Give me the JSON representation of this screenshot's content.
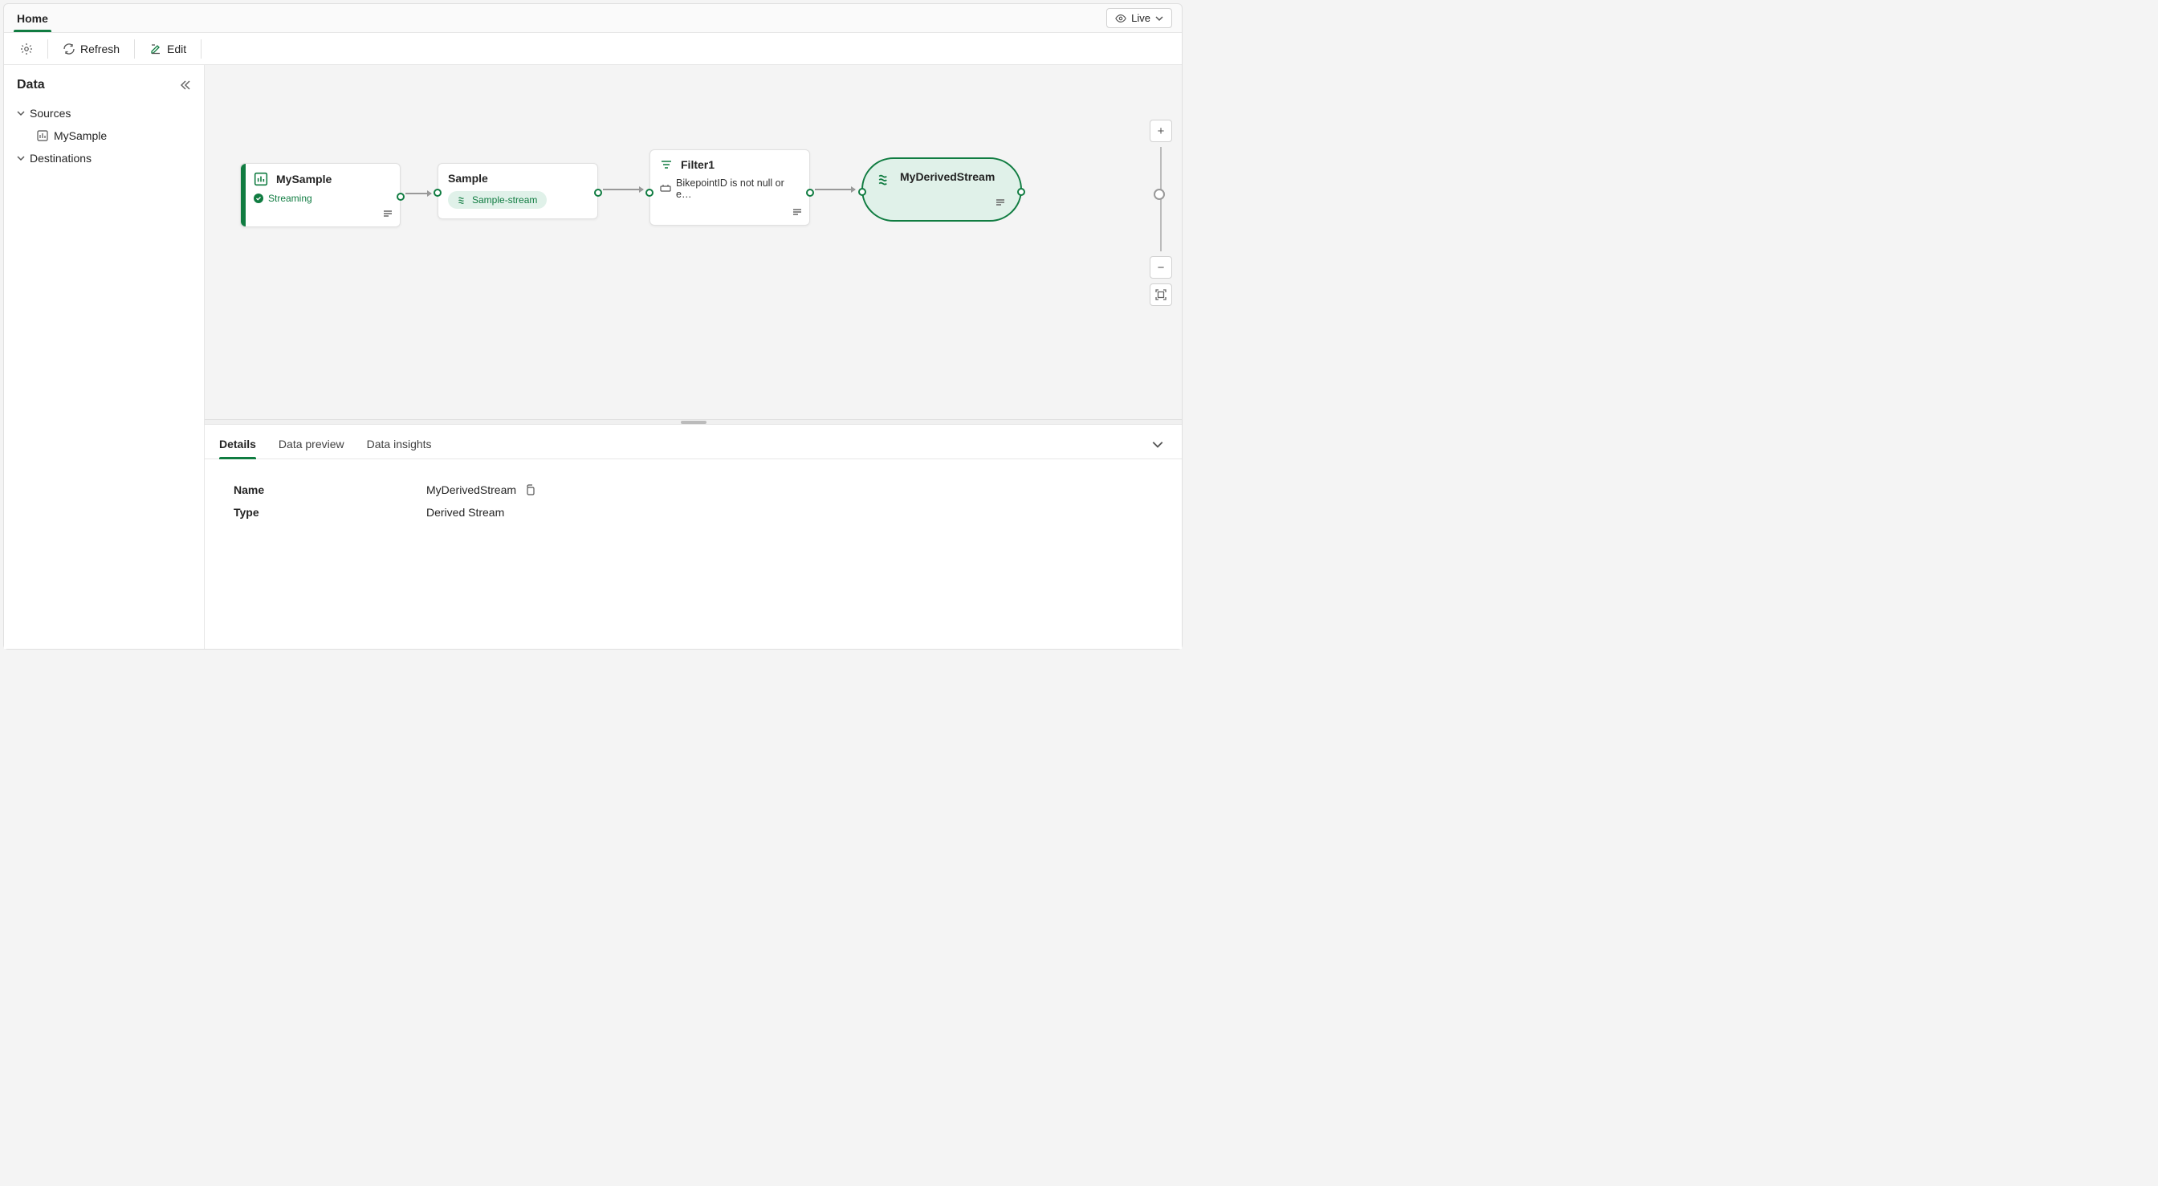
{
  "tabs": {
    "home": "Home"
  },
  "live": "Live",
  "toolbar": {
    "refresh": "Refresh",
    "edit": "Edit"
  },
  "sidebar": {
    "title": "Data",
    "sources": "Sources",
    "source_item": "MySample",
    "destinations": "Destinations"
  },
  "nodes": {
    "source": {
      "title": "MySample",
      "status": "Streaming"
    },
    "sample": {
      "title": "Sample",
      "chip": "Sample-stream"
    },
    "filter": {
      "title": "Filter1",
      "cond": "BikepointID is not null or e…"
    },
    "derived": {
      "title": "MyDerivedStream"
    }
  },
  "detail_tabs": {
    "details": "Details",
    "preview": "Data preview",
    "insights": "Data insights"
  },
  "details": {
    "name_label": "Name",
    "name_value": "MyDerivedStream",
    "type_label": "Type",
    "type_value": "Derived Stream"
  }
}
